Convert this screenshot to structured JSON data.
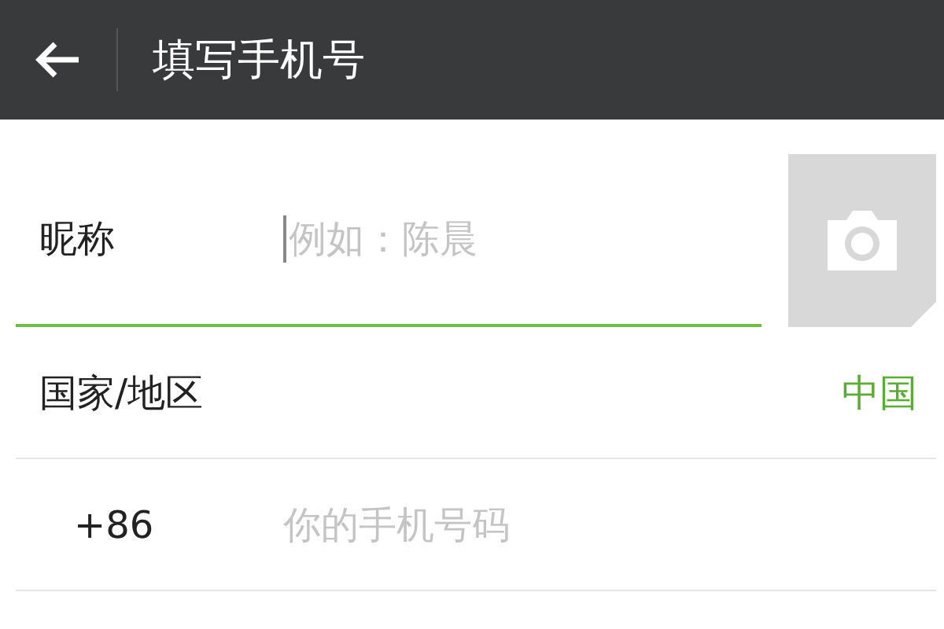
{
  "header": {
    "title": "填写手机号"
  },
  "nickname": {
    "label": "昵称",
    "placeholder": "例如：陈晨",
    "focused": true
  },
  "country": {
    "label": "国家/地区",
    "value": "中国"
  },
  "phone": {
    "code": "+86",
    "placeholder": "你的手机号码"
  }
}
